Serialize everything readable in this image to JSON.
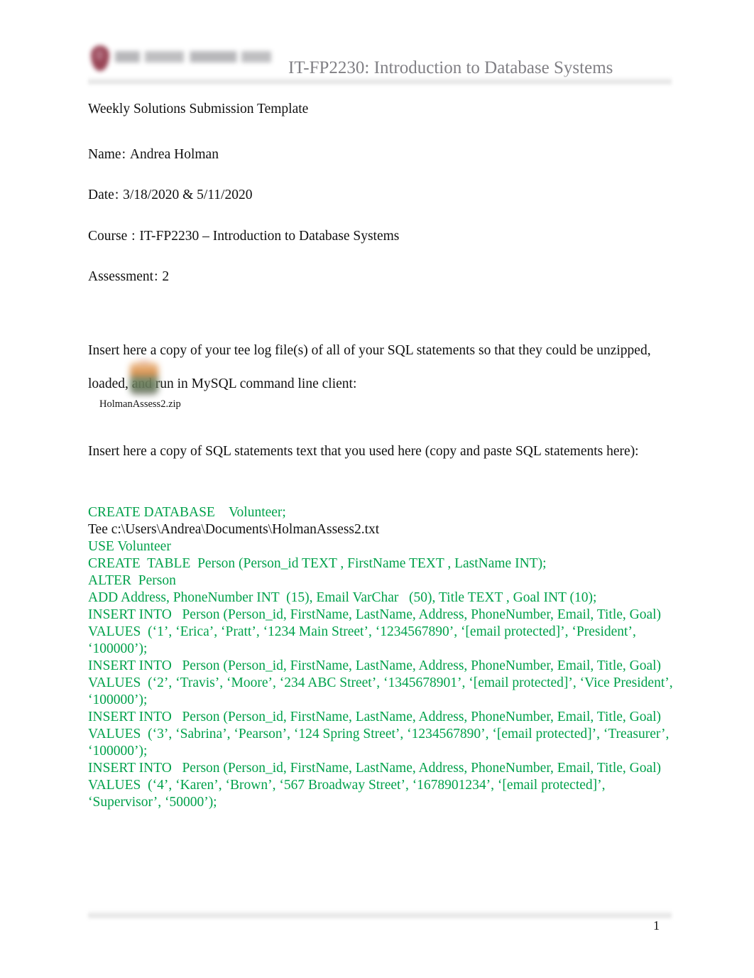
{
  "document": {
    "header": {
      "logo_name": "university-logo",
      "logo_color": "#8c2d40",
      "title": "IT-FP2230: Introduction to Database Systems",
      "title_color": "#818085"
    },
    "template_title": "Weekly Solutions Submission Template",
    "fields": [
      {
        "label": "Name",
        "separator": ":",
        "value": "Andrea Holman"
      },
      {
        "label": "Date",
        "separator": ":",
        "value": "3/18/2020 & 5/11/2020"
      },
      {
        "label": "Course",
        "separator": ":",
        "value": "IT-FP2230 – Introduction to Database Systems"
      },
      {
        "label": "Assessment",
        "separator": ":",
        "value": "2"
      }
    ],
    "instruction_1": "Insert here a copy of your tee log file(s) of all of your SQL statements so that they could be unzipped, loaded, and run in MySQL command line client:",
    "attachment": {
      "icon_name": "zip-file-icon",
      "filename": "HolmanAssess2.zip"
    },
    "instruction_2": "Insert here a copy of SQL statements text that you used here (copy and paste SQL statements here):",
    "sql": {
      "color": "#00A14B",
      "plain_color": "#111111",
      "lines": [
        {
          "text": "CREATE DATABASE    Volunteer;",
          "style": "keyword"
        },
        {
          "text": "Tee c:\\Users\\Andrea\\Documents\\HolmanAssess2.txt",
          "style": "plain"
        },
        {
          "text": "USE Volunteer",
          "style": "keyword"
        },
        {
          "text": "CREATE  TABLE  Person (Person_id TEXT , FirstName TEXT , LastName INT);",
          "style": "keyword"
        },
        {
          "text": "ALTER  Person",
          "style": "keyword"
        },
        {
          "text": "ADD Address, PhoneNumber INT  (15), Email VarChar   (50), Title TEXT , Goal INT (10);",
          "style": "keyword"
        },
        {
          "text": "INSERT INTO   Person (Person_id, FirstName, LastName, Address, PhoneNumber, Email, Title, Goal)",
          "style": "keyword"
        },
        {
          "text": "VALUES  (‘1’, ‘Erica’, ‘Pratt’, ‘1234 Main Street’, ‘1234567890’, ‘[email protected]’, ‘President’, ‘100000’);",
          "style": "keyword"
        },
        {
          "text": "INSERT INTO   Person (Person_id, FirstName, LastName, Address, PhoneNumber, Email, Title, Goal)",
          "style": "keyword"
        },
        {
          "text": "VALUES  (‘2’, ‘Travis’, ‘Moore’, ‘234 ABC Street’, ‘1345678901’, ‘[email protected]’, ‘Vice President’, ‘100000’);",
          "style": "keyword"
        },
        {
          "text": "INSERT INTO   Person (Person_id, FirstName, LastName, Address, PhoneNumber, Email, Title, Goal)",
          "style": "keyword"
        },
        {
          "text": "VALUES  (‘3’, ‘Sabrina’, ‘Pearson’, ‘124 Spring Street’, ‘1234567890’, ‘[email protected]’, ‘Treasurer’, ‘100000’);",
          "style": "keyword"
        },
        {
          "text": "INSERT INTO   Person (Person_id, FirstName, LastName, Address, PhoneNumber, Email, Title, Goal)",
          "style": "keyword"
        },
        {
          "text": "VALUES  (‘4’, ‘Karen’, ‘Brown’, ‘567 Broadway Street’, ‘1678901234’, ‘[email protected]’, ‘Supervisor’, ‘50000’);",
          "style": "keyword"
        }
      ]
    },
    "footer": {
      "page_number": "1"
    }
  }
}
